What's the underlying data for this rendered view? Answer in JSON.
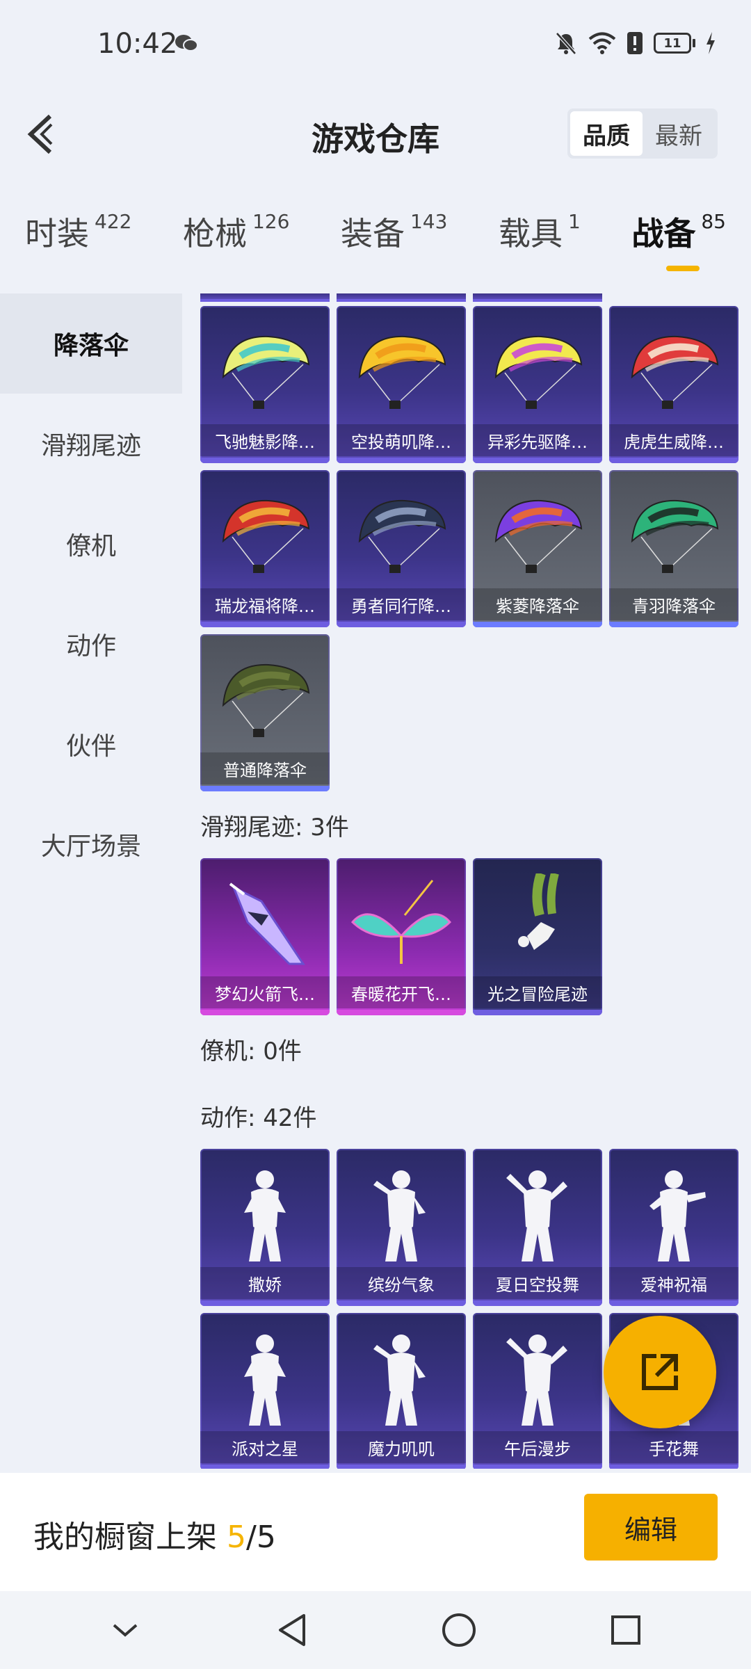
{
  "status": {
    "time": "10:42",
    "battery": "11"
  },
  "header": {
    "title": "游戏仓库",
    "sort_options": [
      "品质",
      "最新"
    ]
  },
  "tabs": [
    {
      "label": "时装",
      "count": "422"
    },
    {
      "label": "枪械",
      "count": "126"
    },
    {
      "label": "装备",
      "count": "143"
    },
    {
      "label": "载具",
      "count": "1"
    },
    {
      "label": "战备",
      "count": "85"
    }
  ],
  "sidebar": {
    "items": [
      "降落伞",
      "滑翔尾迹",
      "僚机",
      "动作",
      "伙伴",
      "大厅场景"
    ]
  },
  "parachutes": [
    {
      "name": "飞驰魅影降…",
      "style": "purple",
      "icon": "parachute-icon",
      "colors": [
        "#e9f07a",
        "#46c9c9"
      ]
    },
    {
      "name": "空投萌叽降…",
      "style": "purple",
      "icon": "parachute-icon",
      "colors": [
        "#f7c52b",
        "#f09a1a"
      ]
    },
    {
      "name": "异彩先驱降…",
      "style": "purple",
      "icon": "parachute-icon",
      "colors": [
        "#f2e94e",
        "#c94ad6"
      ]
    },
    {
      "name": "虎虎生威降…",
      "style": "purple",
      "icon": "parachute-icon",
      "colors": [
        "#e03b3b",
        "#f7e6d0"
      ]
    },
    {
      "name": "瑞龙福将降…",
      "style": "purple",
      "icon": "parachute-icon",
      "colors": [
        "#d4342b",
        "#f2b33a"
      ]
    },
    {
      "name": "勇者同行降…",
      "style": "purple",
      "icon": "parachute-icon",
      "colors": [
        "#2a3552",
        "#8fa0c2"
      ]
    },
    {
      "name": "紫菱降落伞",
      "style": "gray",
      "icon": "parachute-icon",
      "colors": [
        "#7b3fe0",
        "#f06a2a"
      ]
    },
    {
      "name": "青羽降落伞",
      "style": "gray",
      "icon": "parachute-icon",
      "colors": [
        "#2db37a",
        "#1d2b25"
      ]
    },
    {
      "name": "普通降落伞",
      "style": "gray",
      "icon": "parachute-icon",
      "colors": [
        "#4b5a2a",
        "#6e7d3c"
      ]
    }
  ],
  "glide_trails": {
    "title": "滑翔尾迹: 3件",
    "items": [
      {
        "name": "梦幻火箭飞…",
        "style": "pink",
        "icon": "rocket-glider-icon"
      },
      {
        "name": "春暖花开飞…",
        "style": "pink",
        "icon": "butterfly-glider-icon"
      },
      {
        "name": "光之冒险尾迹",
        "style": "night",
        "icon": "skydiver-trail-icon"
      }
    ]
  },
  "wingman": {
    "title": "僚机: 0件"
  },
  "emotes": {
    "title": "动作: 42件",
    "items": [
      {
        "name": "撒娇",
        "icon": "emote-figure-icon"
      },
      {
        "name": "缤纷气象",
        "icon": "emote-figure-icon"
      },
      {
        "name": "夏日空投舞",
        "icon": "emote-figure-icon"
      },
      {
        "name": "爱神祝福",
        "icon": "emote-figure-icon"
      },
      {
        "name": "派对之星",
        "icon": "emote-figure-icon"
      },
      {
        "name": "魔力叽叽",
        "icon": "emote-figure-icon"
      },
      {
        "name": "午后漫步",
        "icon": "emote-figure-icon"
      },
      {
        "name": "手花舞",
        "icon": "emote-figure-icon"
      }
    ]
  },
  "showcase": {
    "label": "我的橱窗上架",
    "current": "5",
    "total": "/5",
    "edit_label": "编辑"
  },
  "accent_color": "#f6b000"
}
